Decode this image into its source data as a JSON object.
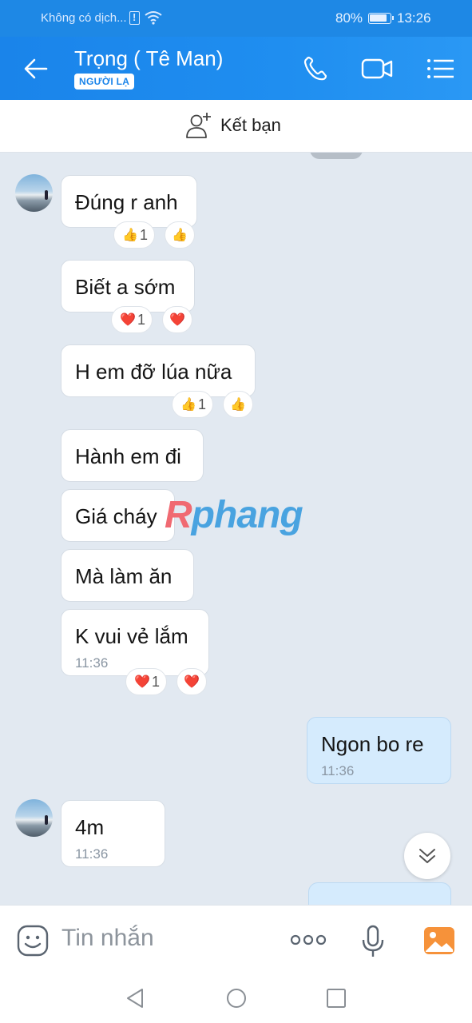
{
  "status_bar": {
    "carrier": "Không có dịch...",
    "battery": "80%",
    "time": "13:26"
  },
  "header": {
    "title": "Trọng ( Tê Man)",
    "badge": "NGƯỜI LẠ"
  },
  "friend_bar": {
    "label": "Kết bạn"
  },
  "messages": [
    {
      "text": "Đúng r anh",
      "reaction": "like",
      "reaction_count": "1"
    },
    {
      "text": "Biết a sớm",
      "reaction": "heart",
      "reaction_count": "1"
    },
    {
      "text": "H em đỡ lúa nữa",
      "reaction": "like",
      "reaction_count": "1"
    },
    {
      "text": "Hành em đi"
    },
    {
      "text": "Giá cháy"
    },
    {
      "text": "Mà làm ăn"
    },
    {
      "text": "K vui vẻ lắm",
      "time": "11:36",
      "reaction": "heart",
      "reaction_count": "1"
    },
    {
      "text": "Ngon bo re",
      "time": "11:36",
      "outgoing": true
    },
    {
      "text": "4m",
      "time": "11:36"
    }
  ],
  "watermark": {
    "first": "R",
    "rest": "phang"
  },
  "input": {
    "placeholder": "Tin nhắn"
  },
  "icons": {
    "back": "back-arrow-icon",
    "call": "phone-icon",
    "video": "video-call-icon",
    "menu": "list-menu-icon",
    "add_friend": "add-friend-icon",
    "emoji": "emoji-icon",
    "more": "more-dots-icon",
    "mic": "microphone-icon",
    "image": "image-icon"
  },
  "colors": {
    "header": "#1e88e5",
    "outgoing_bubble": "#d5ebfd",
    "background": "#e2e9f1"
  }
}
